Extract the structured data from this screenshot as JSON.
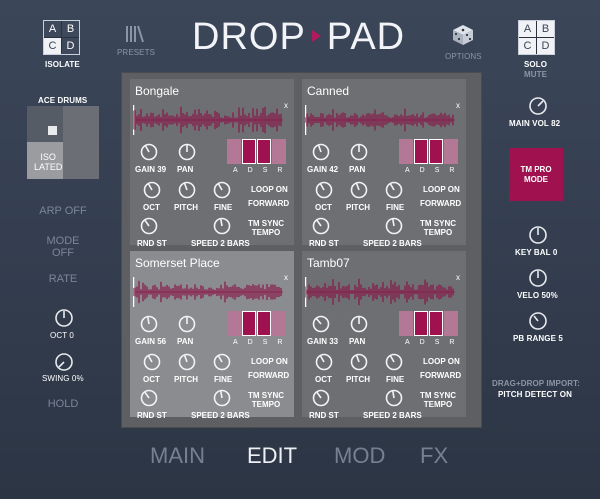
{
  "header": {
    "logo_left": "DROP",
    "logo_right": "PAD",
    "isolate_label": "ISOLATE",
    "presets_label": "PRESETS",
    "options_label": "OPTIONS",
    "solo_label": "SOLO",
    "mute_label": "MUTE",
    "grid_letters": [
      "A",
      "B",
      "C",
      "D"
    ]
  },
  "left": {
    "kit_name": "ACE DRUMS",
    "isolated_label": "ISO\nLATED",
    "arp": "ARP OFF",
    "mode": "MODE\nOFF",
    "rate": "RATE",
    "oct": "OCT 0",
    "swing": "SWING 0%",
    "hold": "HOLD"
  },
  "right": {
    "main_vol": "MAIN VOL 82",
    "tm_pro_mode": "TM PRO\nMODE",
    "key_bal": "KEY BAL 0",
    "velo": "VELO 50%",
    "pb_range": "PB RANGE 5",
    "dragdrop": "DRAG+DROP IMPORT:",
    "pitch_detect": "PITCH DETECT ON"
  },
  "pads": [
    {
      "name": "Bongale",
      "gain": "GAIN 39",
      "env": [
        0,
        1,
        1,
        0
      ]
    },
    {
      "name": "Canned",
      "gain": "GAIN 42",
      "env": [
        0,
        1,
        1,
        0
      ]
    },
    {
      "name": "Somerset Place",
      "gain": "GAIN 56",
      "env": [
        0,
        1,
        1,
        0
      ]
    },
    {
      "name": "Tamb07",
      "gain": "GAIN 33",
      "env": [
        0,
        1,
        1,
        0
      ]
    }
  ],
  "pad_labels": {
    "close": "x",
    "pan": "PAN",
    "oct": "OCT",
    "pitch": "PITCH",
    "fine": "FINE",
    "loop": "LOOP ON",
    "forward": "FORWARD",
    "tm_sync": "TM SYNC\nTEMPO",
    "rnd_st": "RND ST",
    "speed": "SPEED  2 BARS",
    "adsr": [
      "A",
      "D",
      "S",
      "R"
    ]
  },
  "tabs": [
    {
      "label": "MAIN",
      "active": false
    },
    {
      "label": "EDIT",
      "active": true
    },
    {
      "label": "MOD",
      "active": false
    },
    {
      "label": "FX",
      "active": false
    }
  ],
  "colors": {
    "accent": "#a0124f",
    "background": "#36404f",
    "pad_bg": "#6e6f72",
    "pad_selected": "#8b8c8f"
  }
}
